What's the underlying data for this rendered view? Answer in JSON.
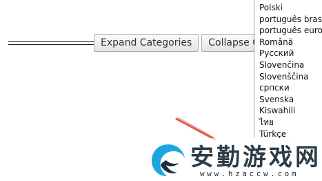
{
  "toolbar": {
    "expand_label": "Expand Categories",
    "collapse_label": "Collapse Categories"
  },
  "languages": [
    "Polski",
    "português brasileiro",
    "português europeu",
    "Română",
    "Русский",
    "Slovenčina",
    "Slovenščina",
    "српски",
    "Svenska",
    "Kiswahili",
    "ไทย",
    "Türkçe"
  ],
  "watermark": {
    "title": "安勤游戏网",
    "url": "www.hzaccw.com",
    "logo_colors": [
      "#1da7e2",
      "#1f2d3a"
    ]
  },
  "colors": {
    "button_border": "#a9a9a9",
    "text": "#333333",
    "arrow": "#d9413a"
  }
}
